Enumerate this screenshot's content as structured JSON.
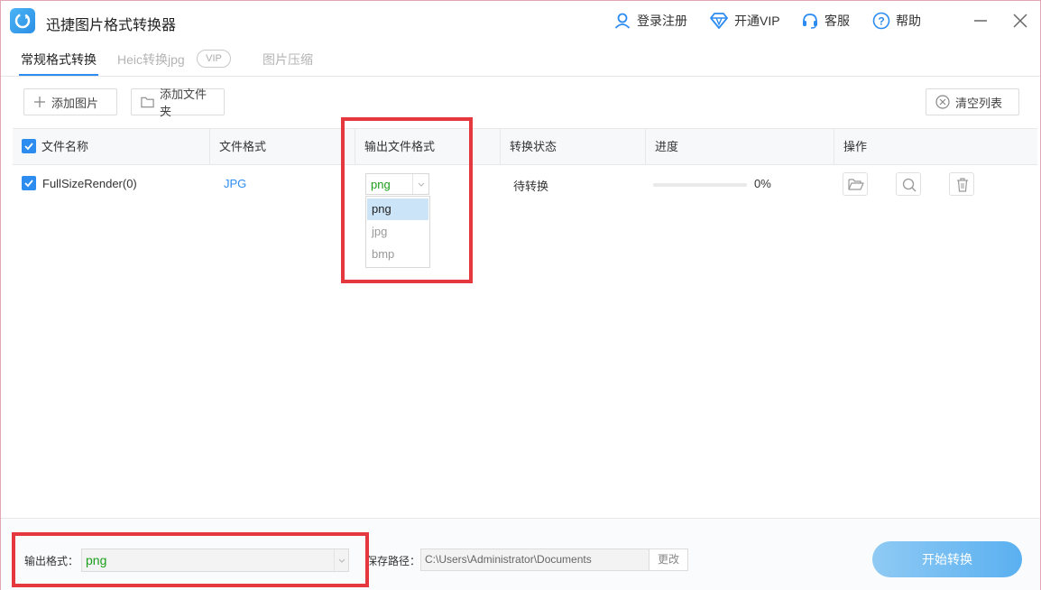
{
  "app": {
    "title": "迅捷图片格式转换器"
  },
  "titlebar": {
    "login": "登录注册",
    "vip": "开通VIP",
    "service": "客服",
    "help": "帮助"
  },
  "tabs": [
    {
      "label": "常规格式转换",
      "active": true
    },
    {
      "label": "Heic转换jpg",
      "badge": "VIP",
      "active": false
    },
    {
      "label": "图片压缩",
      "active": false
    }
  ],
  "toolbar": {
    "add_image": "添加图片",
    "add_folder": "添加文件夹",
    "clear_list": "清空列表"
  },
  "table": {
    "columns": [
      "文件名称",
      "文件格式",
      "输出文件格式",
      "转换状态",
      "进度",
      "操作"
    ],
    "rows": [
      {
        "checked": true,
        "name": "FullSizeRender(0)",
        "format": "JPG",
        "output_format": "png",
        "status": "待转换",
        "progress_text": "0%",
        "progress": 0
      }
    ]
  },
  "output_dropdown": {
    "options": [
      "png",
      "jpg",
      "bmp"
    ],
    "selected": "png"
  },
  "bottom": {
    "output_label": "输出格式：",
    "output_value": "png",
    "path_label": "保存路径：",
    "path_value": "C:\\Users\\Administrator\\Documents",
    "change_label": "更改",
    "start_label": "开始转换"
  },
  "colors": {
    "accent": "#2d8cf0",
    "highlight": "#e5373e",
    "format_green": "#1a9d1a",
    "start_button": "#5ab0f0"
  }
}
